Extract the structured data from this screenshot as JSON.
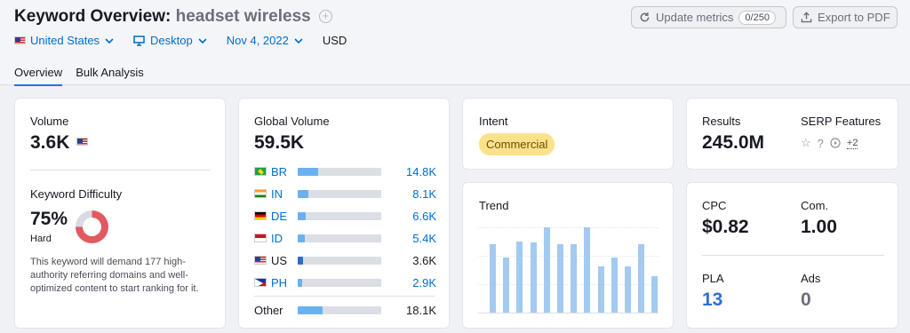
{
  "header": {
    "title_prefix": "Keyword Overview:",
    "keyword": "headset wireless",
    "update_label": "Update metrics",
    "update_counter": "0/250",
    "export_label": "Export to PDF"
  },
  "filters": {
    "country": "United States",
    "device": "Desktop",
    "date": "Nov 4, 2022",
    "currency": "USD"
  },
  "tabs": [
    "Overview",
    "Bulk Analysis"
  ],
  "volume": {
    "label": "Volume",
    "value": "3.6K"
  },
  "difficulty": {
    "label": "Keyword Difficulty",
    "value": "75%",
    "level": "Hard",
    "percent": 75,
    "description": "This keyword will demand 177 high-authority referring domains and well-optimized content to start ranking for it."
  },
  "global_volume": {
    "label": "Global Volume",
    "value": "59.5K",
    "countries": [
      {
        "code": "BR",
        "value": "14.8K",
        "share": 0.24
      },
      {
        "code": "IN",
        "value": "8.1K",
        "share": 0.13
      },
      {
        "code": "DE",
        "value": "6.6K",
        "share": 0.1
      },
      {
        "code": "ID",
        "value": "5.4K",
        "share": 0.09
      },
      {
        "code": "US",
        "value": "3.6K",
        "share": 0.06
      },
      {
        "code": "PH",
        "value": "2.9K",
        "share": 0.05
      }
    ],
    "other_label": "Other",
    "other_value": "18.1K",
    "other_share": 0.3
  },
  "intent": {
    "label": "Intent",
    "value": "Commercial"
  },
  "trend": {
    "label": "Trend",
    "values": [
      0.77,
      0.62,
      0.8,
      0.79,
      0.96,
      0.77,
      0.77,
      0.96,
      0.52,
      0.62,
      0.52,
      0.77,
      0.41
    ]
  },
  "results": {
    "label": "Results",
    "value": "245.0M"
  },
  "serp": {
    "label": "SERP Features",
    "more": "+2"
  },
  "cpc": {
    "label": "CPC",
    "value": "$0.82"
  },
  "com": {
    "label": "Com.",
    "value": "1.00"
  },
  "pla": {
    "label": "PLA",
    "value": "13"
  },
  "ads": {
    "label": "Ads",
    "value": "0"
  },
  "colors": {
    "accent": "#006dca",
    "intent_badge": "#fbe28a",
    "difficulty_hard": "#e05a61",
    "bar": "#6ab1ef",
    "trend_bar": "#a3caf0"
  }
}
